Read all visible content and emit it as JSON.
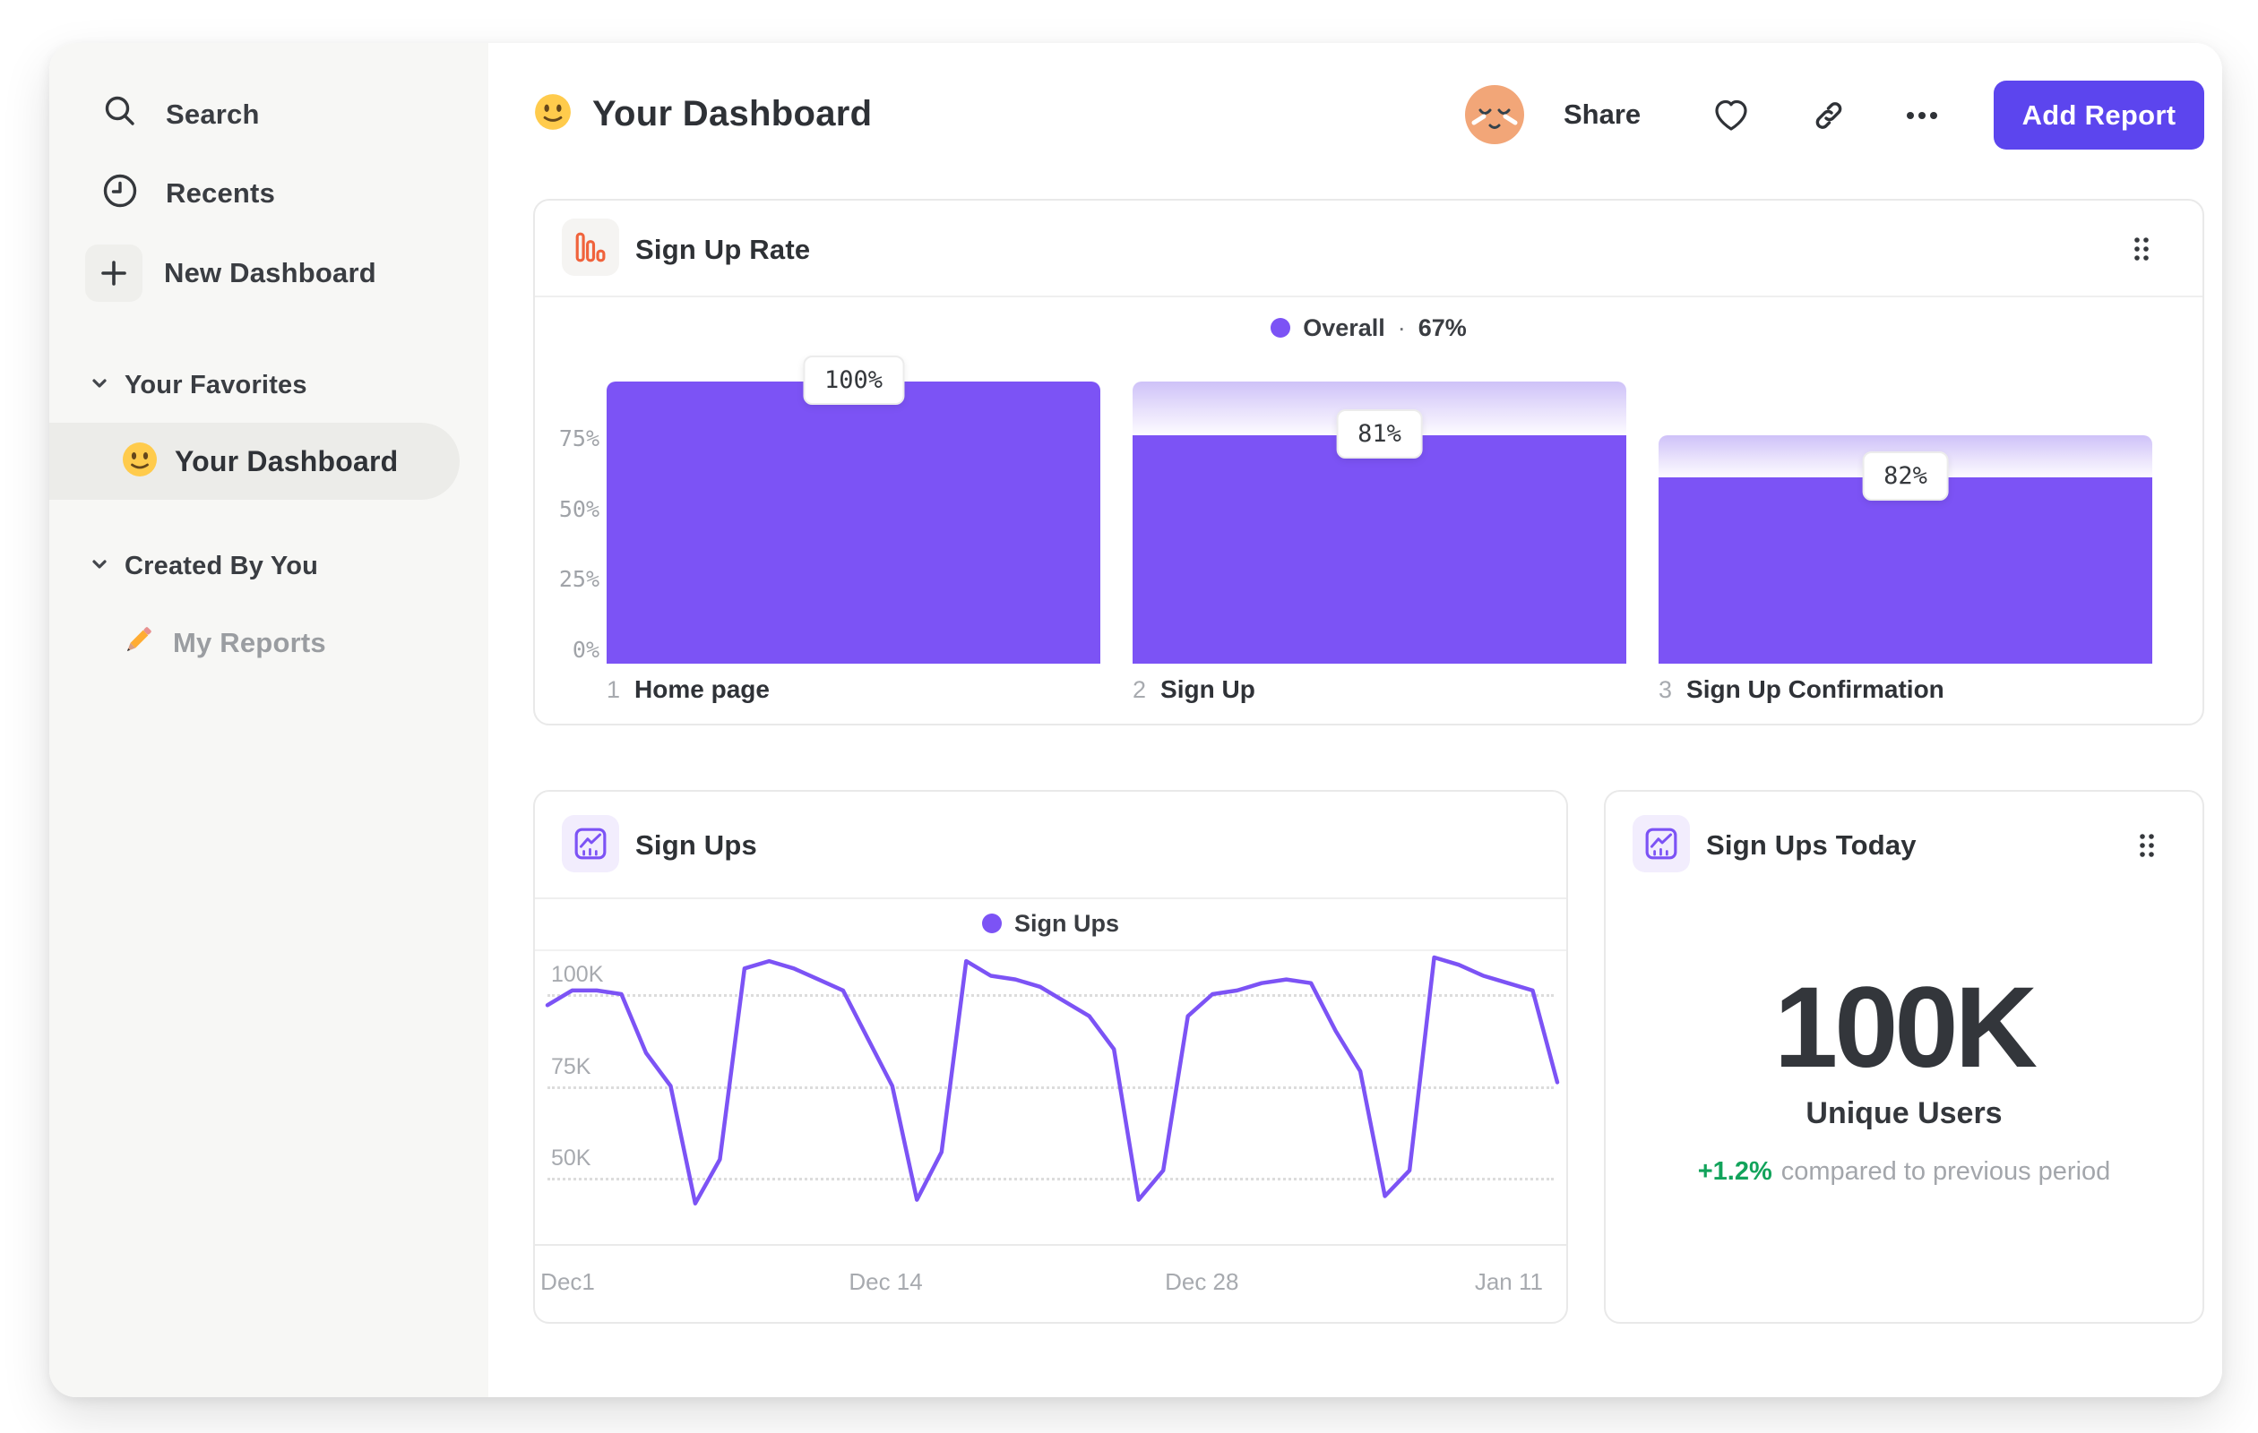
{
  "colors": {
    "accent_purple": "#7C53F5",
    "button_purple": "#5C45EE",
    "gradient_cap_top": "#CEC1F8",
    "icon_orange": "#F0633C",
    "green_positive": "#12A35B",
    "text_dark": "#2F3237",
    "text_gray": "#A0A3A8",
    "sidebar_bg": "#F7F7F5",
    "avatar_bg": "#F2A678"
  },
  "icons": {
    "search": "magnifier",
    "recents": "clock",
    "new_dashboard": "plus",
    "section_toggle": "chevron-down",
    "dashboard_item": "smiley-emoji",
    "my_reports_item": "pencil-emoji",
    "page_title": "smiley-emoji",
    "avatar": "relieved-face-avatar",
    "favorite": "heart-outline",
    "copy_link": "link-chain",
    "more": "ellipsis",
    "drag": "drag-handle-dots",
    "funnel_card": "funnel-bars-orange",
    "line_card": "line-chart-purple"
  },
  "sidebar": {
    "items": [
      {
        "label": "Search"
      },
      {
        "label": "Recents"
      },
      {
        "label": "New Dashboard"
      }
    ],
    "sections": [
      {
        "label": "Your Favorites",
        "items": [
          {
            "label": "Your Dashboard",
            "selected": true
          }
        ]
      },
      {
        "label": "Created By You",
        "items": [
          {
            "label": "My Reports",
            "selected": false
          }
        ]
      }
    ]
  },
  "header": {
    "title": "Your Dashboard",
    "share_label": "Share",
    "add_report_label": "Add Report"
  },
  "cards": {
    "sign_up_rate": {
      "title": "Sign Up Rate",
      "legend_label": "Overall",
      "legend_sep": "·",
      "legend_value": "67%"
    },
    "sign_ups": {
      "title": "Sign Ups",
      "legend_label": "Sign Ups"
    },
    "sign_ups_today": {
      "title": "Sign Ups Today",
      "value": "100K",
      "subtitle": "Unique Users",
      "delta": "+1.2%",
      "delta_note": "compared to previous period"
    }
  },
  "chart_data": [
    {
      "id": "sign-up-rate-funnel",
      "type": "bar",
      "subtype": "funnel",
      "title": "Sign Up Rate",
      "legend": "Overall",
      "overall_conversion": "67%",
      "categories": [
        "Home page",
        "Sign Up",
        "Sign Up Confirmation"
      ],
      "step_indices": [
        "1",
        "2",
        "3"
      ],
      "value_labels": [
        "100%",
        "81%",
        "82%"
      ],
      "step_conversion_pct": [
        100,
        81,
        82
      ],
      "overall_pct": [
        100,
        81,
        66
      ],
      "prev_pct": [
        100,
        100,
        81
      ],
      "y_ticks": [
        "75%",
        "50%",
        "25%",
        "0%"
      ],
      "y_tick_values": [
        75,
        50,
        25,
        0
      ],
      "ylim": [
        0,
        100
      ],
      "grid": false,
      "legend_position": "top-center",
      "bar_color": "#7C53F5"
    },
    {
      "id": "sign-ups-line",
      "type": "line",
      "title": "Sign Ups",
      "legend": "Sign Ups",
      "line_color": "#7C53F5",
      "grid": "dotted-horizontal",
      "legend_position": "top-center",
      "x_range": [
        "Dec 1",
        "Jan 12"
      ],
      "x_ticks": [
        {
          "label": "Dec1",
          "frac": 0.02
        },
        {
          "label": "Dec 14",
          "frac": 0.335
        },
        {
          "label": "Dec 28",
          "frac": 0.648
        },
        {
          "label": "Jan 11",
          "frac": 0.952
        }
      ],
      "y_ticks": [
        {
          "label": "100K",
          "value": 100
        },
        {
          "label": "75K",
          "value": 75
        },
        {
          "label": "50K",
          "value": 50
        }
      ],
      "ylim_k": [
        30,
        112
      ],
      "values_k": [
        97,
        101,
        101,
        100,
        84,
        75,
        43,
        55,
        107,
        109,
        107,
        104,
        101,
        88,
        75,
        44,
        57,
        109,
        105,
        104,
        102,
        98,
        94,
        85,
        44,
        52,
        94,
        100,
        101,
        103,
        104,
        103,
        90,
        79,
        45,
        52,
        110,
        108,
        105,
        103,
        101,
        76
      ]
    }
  ]
}
